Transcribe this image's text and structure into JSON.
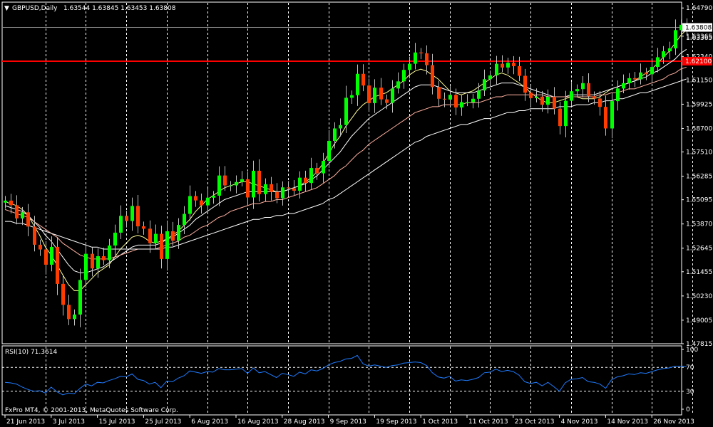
{
  "header": {
    "menu_glyph": "▼",
    "symbol_label": "GBPUSD,Daily",
    "ohlc_label": "1.63544 1.63845 1.63453 1.63808"
  },
  "footer": {
    "copyright": "FxPro MT4, © 2001-2013, MetaQuotes Software Corp."
  },
  "colors": {
    "background": "#000000",
    "frame": "#ffffff",
    "grid": "#ffffff",
    "bull": "#00ff00",
    "bear": "#ff3c00",
    "wick": "#bfbfbf",
    "resistance_line": "#ff0000",
    "price_tag": "#ffffff",
    "ma_fast": "#ffff99",
    "ma_mid": "#ffffff",
    "ma_slow": "#ffb0a0",
    "ma_long": "#ffffff",
    "rsi_line": "#1e7bff"
  },
  "chart_data": [
    {
      "type": "candlestick",
      "symbol": "GBPUSD",
      "timeframe": "Daily",
      "current_price": 1.63808,
      "current_price_label": "1.63808",
      "hidden_price_label": "1.63365",
      "horizontal_line": {
        "value": 1.621,
        "label": "1.62100"
      },
      "ylim": [
        1.4785,
        1.6505
      ],
      "y_ticks": [
        "1.64790",
        "1.63365",
        "1.62340",
        "1.61150",
        "1.59925",
        "1.58700",
        "1.57510",
        "1.56285",
        "1.55095",
        "1.53870",
        "1.52645",
        "1.51455",
        "1.50230",
        "1.49005",
        "1.47815"
      ],
      "x_ticks": [
        {
          "label": "21 Jun 2013",
          "i": 0
        },
        {
          "label": "3 Jul 2013",
          "i": 8
        },
        {
          "label": "15 Jul 2013",
          "i": 16
        },
        {
          "label": "25 Jul 2013",
          "i": 24
        },
        {
          "label": "6 Aug 2013",
          "i": 32
        },
        {
          "label": "16 Aug 2013",
          "i": 40
        },
        {
          "label": "28 Aug 2013",
          "i": 48
        },
        {
          "label": "9 Sep 2013",
          "i": 56
        },
        {
          "label": "19 Sep 2013",
          "i": 64
        },
        {
          "label": "1 Oct 2013",
          "i": 72
        },
        {
          "label": "11 Oct 2013",
          "i": 80
        },
        {
          "label": "23 Oct 2013",
          "i": 88
        },
        {
          "label": "4 Nov 2013",
          "i": 96
        },
        {
          "label": "14 Nov 2013",
          "i": 104
        },
        {
          "label": "26 Nov 2013",
          "i": 112
        }
      ],
      "vertical_grid_index": [
        7,
        14,
        21,
        28,
        35,
        42,
        49,
        56,
        63,
        70,
        77,
        84,
        91,
        98,
        105,
        112,
        119
      ],
      "close": [
        1.5505,
        1.5482,
        1.5415,
        1.5446,
        1.5374,
        1.5282,
        1.5258,
        1.5181,
        1.5271,
        1.5084,
        1.4978,
        1.4906,
        1.4929,
        1.5104,
        1.5236,
        1.5162,
        1.5224,
        1.5204,
        1.5278,
        1.5343,
        1.5428,
        1.5402,
        1.5478,
        1.5375,
        1.5363,
        1.529,
        1.5337,
        1.521,
        1.535,
        1.5302,
        1.5382,
        1.5438,
        1.5528,
        1.5506,
        1.5481,
        1.552,
        1.553,
        1.5632,
        1.5582,
        1.5582,
        1.5599,
        1.5613,
        1.5521,
        1.5656,
        1.5538,
        1.5588,
        1.5549,
        1.5517,
        1.5572,
        1.5567,
        1.5555,
        1.5621,
        1.5594,
        1.567,
        1.5643,
        1.5706,
        1.5807,
        1.587,
        1.5887,
        1.6025,
        1.6038,
        1.6146,
        1.6087,
        1.5998,
        1.6076,
        1.6017,
        1.5999,
        1.6072,
        1.6108,
        1.6166,
        1.6197,
        1.6254,
        1.625,
        1.619,
        1.6079,
        1.602,
        1.6016,
        1.604,
        1.5976,
        1.6003,
        1.6003,
        1.602,
        1.6062,
        1.6119,
        1.6138,
        1.6197,
        1.6178,
        1.6202,
        1.6185,
        1.6136,
        1.6051,
        1.6023,
        1.6031,
        1.599,
        1.603,
        1.597,
        1.5882,
        1.601,
        1.6058,
        1.6069,
        1.6099,
        1.6033,
        1.6021,
        1.5979,
        1.587,
        1.6008,
        1.6072,
        1.6099,
        1.6124,
        1.6118,
        1.6153,
        1.6144,
        1.6181,
        1.623,
        1.626,
        1.6275,
        1.6367,
        1.6394,
        1.6381
      ],
      "series": [
        {
          "name": "MA fast",
          "values": [
            1.55,
            1.549,
            1.548,
            1.546,
            1.543,
            1.538,
            1.533,
            1.527,
            1.523,
            1.518,
            1.513,
            1.508,
            1.505,
            1.505,
            1.508,
            1.511,
            1.514,
            1.516,
            1.518,
            1.522,
            1.526,
            1.529,
            1.532,
            1.533,
            1.532,
            1.53,
            1.529,
            1.53,
            1.531,
            1.533,
            1.535,
            1.538,
            1.541,
            1.545,
            1.548,
            1.551,
            1.553,
            1.555,
            1.557,
            1.558,
            1.559,
            1.56,
            1.56,
            1.559,
            1.558,
            1.557,
            1.556,
            1.555,
            1.555,
            1.556,
            1.557,
            1.558,
            1.56,
            1.562,
            1.565,
            1.569,
            1.574,
            1.579,
            1.583,
            1.588,
            1.592,
            1.596,
            1.599,
            1.601,
            1.603,
            1.604,
            1.605,
            1.607,
            1.609,
            1.611,
            1.614,
            1.616,
            1.617,
            1.616,
            1.614,
            1.612,
            1.609,
            1.606,
            1.605,
            1.604,
            1.605,
            1.606,
            1.608,
            1.61,
            1.612,
            1.614,
            1.615,
            1.614,
            1.612,
            1.61,
            1.608,
            1.605,
            1.603,
            1.601,
            1.6,
            1.6,
            1.601,
            1.602,
            1.603,
            1.603,
            1.602,
            1.602,
            1.602,
            1.603,
            1.605,
            1.607,
            1.608,
            1.609,
            1.61,
            1.611,
            1.613,
            1.615,
            1.617,
            1.62,
            1.623,
            1.626,
            1.63,
            1.634,
            1.637
          ]
        },
        {
          "name": "MA mid",
          "values": [
            1.548,
            1.547,
            1.546,
            1.545,
            1.543,
            1.54,
            1.537,
            1.533,
            1.53,
            1.526,
            1.522,
            1.518,
            1.515,
            1.514,
            1.514,
            1.515,
            1.516,
            1.517,
            1.519,
            1.521,
            1.523,
            1.525,
            1.527,
            1.528,
            1.528,
            1.528,
            1.528,
            1.529,
            1.531,
            1.532,
            1.534,
            1.536,
            1.538,
            1.541,
            1.543,
            1.545,
            1.547,
            1.549,
            1.551,
            1.552,
            1.553,
            1.554,
            1.555,
            1.555,
            1.555,
            1.555,
            1.555,
            1.555,
            1.555,
            1.556,
            1.557,
            1.558,
            1.559,
            1.561,
            1.563,
            1.566,
            1.569,
            1.572,
            1.575,
            1.579,
            1.583,
            1.586,
            1.589,
            1.592,
            1.594,
            1.596,
            1.598,
            1.6,
            1.602,
            1.604,
            1.606,
            1.608,
            1.609,
            1.609,
            1.609,
            1.608,
            1.607,
            1.606,
            1.605,
            1.605,
            1.605,
            1.605,
            1.606,
            1.607,
            1.608,
            1.609,
            1.61,
            1.61,
            1.61,
            1.609,
            1.608,
            1.607,
            1.606,
            1.605,
            1.604,
            1.603,
            1.603,
            1.603,
            1.604,
            1.604,
            1.604,
            1.604,
            1.604,
            1.605,
            1.606,
            1.607,
            1.608,
            1.609,
            1.61,
            1.611,
            1.612,
            1.613,
            1.615,
            1.616,
            1.618,
            1.62,
            1.622,
            1.625,
            1.627
          ]
        },
        {
          "name": "MA slow",
          "values": [
            1.546,
            1.545,
            1.544,
            1.543,
            1.542,
            1.54,
            1.538,
            1.536,
            1.534,
            1.532,
            1.529,
            1.527,
            1.525,
            1.523,
            1.522,
            1.521,
            1.521,
            1.521,
            1.521,
            1.522,
            1.523,
            1.524,
            1.525,
            1.526,
            1.526,
            1.526,
            1.526,
            1.527,
            1.528,
            1.529,
            1.53,
            1.532,
            1.533,
            1.535,
            1.537,
            1.538,
            1.54,
            1.542,
            1.543,
            1.545,
            1.546,
            1.547,
            1.548,
            1.549,
            1.549,
            1.55,
            1.55,
            1.551,
            1.551,
            1.552,
            1.553,
            1.554,
            1.555,
            1.556,
            1.557,
            1.559,
            1.561,
            1.563,
            1.566,
            1.568,
            1.571,
            1.574,
            1.576,
            1.579,
            1.581,
            1.583,
            1.585,
            1.587,
            1.589,
            1.591,
            1.593,
            1.595,
            1.596,
            1.597,
            1.598,
            1.598,
            1.599,
            1.599,
            1.599,
            1.599,
            1.6,
            1.6,
            1.6,
            1.601,
            1.602,
            1.603,
            1.603,
            1.604,
            1.604,
            1.604,
            1.604,
            1.604,
            1.604,
            1.604,
            1.603,
            1.603,
            1.603,
            1.603,
            1.603,
            1.603,
            1.603,
            1.603,
            1.603,
            1.604,
            1.604,
            1.605,
            1.605,
            1.606,
            1.607,
            1.607,
            1.608,
            1.609,
            1.61,
            1.611,
            1.612,
            1.614,
            1.615,
            1.617,
            1.618
          ]
        },
        {
          "name": "MA long",
          "values": [
            1.54,
            1.54,
            1.539,
            1.539,
            1.538,
            1.537,
            1.536,
            1.535,
            1.534,
            1.533,
            1.532,
            1.531,
            1.53,
            1.529,
            1.528,
            1.527,
            1.527,
            1.526,
            1.526,
            1.526,
            1.526,
            1.526,
            1.526,
            1.526,
            1.526,
            1.526,
            1.526,
            1.526,
            1.527,
            1.527,
            1.528,
            1.529,
            1.53,
            1.531,
            1.532,
            1.533,
            1.534,
            1.535,
            1.536,
            1.537,
            1.538,
            1.539,
            1.54,
            1.541,
            1.541,
            1.542,
            1.542,
            1.543,
            1.543,
            1.544,
            1.544,
            1.545,
            1.546,
            1.547,
            1.548,
            1.549,
            1.551,
            1.552,
            1.554,
            1.556,
            1.558,
            1.56,
            1.562,
            1.564,
            1.566,
            1.568,
            1.57,
            1.572,
            1.574,
            1.576,
            1.578,
            1.58,
            1.581,
            1.583,
            1.584,
            1.585,
            1.586,
            1.587,
            1.588,
            1.589,
            1.589,
            1.59,
            1.591,
            1.592,
            1.592,
            1.593,
            1.594,
            1.595,
            1.595,
            1.596,
            1.596,
            1.597,
            1.597,
            1.597,
            1.597,
            1.597,
            1.598,
            1.598,
            1.598,
            1.599,
            1.599,
            1.599,
            1.6,
            1.6,
            1.601,
            1.601,
            1.602,
            1.602,
            1.603,
            1.604,
            1.605,
            1.605,
            1.606,
            1.607,
            1.608,
            1.609,
            1.61,
            1.611,
            1.612
          ]
        }
      ]
    },
    {
      "type": "line",
      "indicator_label": "RSI(10) 71.3614",
      "ylim": [
        0,
        100
      ],
      "y_ticks": [
        "100",
        "70",
        "30",
        "0"
      ],
      "levels": [
        70,
        30
      ],
      "values": [
        45,
        44,
        42,
        37,
        33,
        30,
        31,
        27,
        37,
        29,
        24,
        27,
        26,
        35,
        42,
        39,
        45,
        44,
        48,
        51,
        55,
        54,
        59,
        50,
        48,
        42,
        45,
        36,
        47,
        46,
        52,
        56,
        64,
        62,
        60,
        63,
        62,
        68,
        66,
        66,
        67,
        68,
        60,
        69,
        61,
        63,
        58,
        53,
        60,
        58,
        55,
        62,
        59,
        66,
        64,
        68,
        74,
        78,
        80,
        84,
        85,
        90,
        76,
        72,
        74,
        72,
        70,
        73,
        74,
        77,
        78,
        79,
        78,
        73,
        61,
        54,
        52,
        55,
        47,
        49,
        48,
        50,
        53,
        61,
        62,
        67,
        63,
        65,
        63,
        57,
        46,
        43,
        45,
        39,
        45,
        38,
        30,
        44,
        50,
        51,
        53,
        46,
        45,
        42,
        35,
        49,
        54,
        56,
        59,
        58,
        61,
        60,
        63,
        66,
        68,
        69,
        72,
        72,
        71.3614
      ]
    }
  ]
}
